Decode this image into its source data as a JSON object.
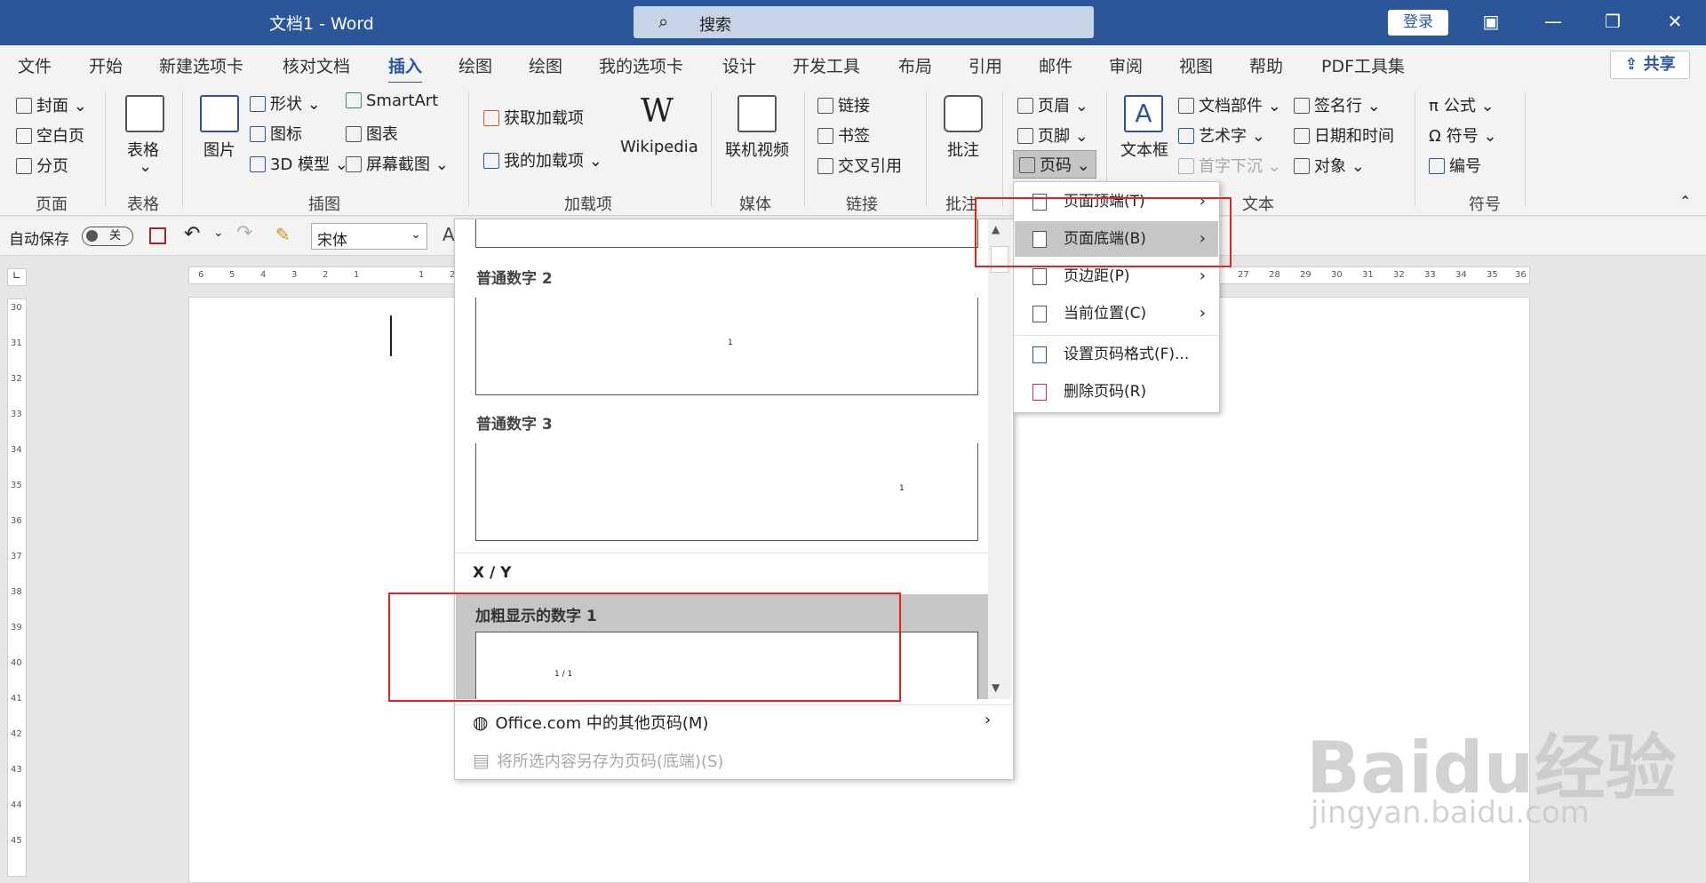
{
  "titlebar": {
    "title": "文档1  -  Word",
    "search_placeholder": "搜索",
    "login": "登录",
    "win_ribbon_opts": "▣",
    "win_minimize": "—",
    "win_restore": "❐",
    "win_close": "✕"
  },
  "tabs": [
    "文件",
    "开始",
    "新建选项卡",
    "核对文档",
    "插入",
    "绘图",
    "绘图",
    "我的选项卡",
    "设计",
    "开发工具",
    "布局",
    "引用",
    "邮件",
    "审阅",
    "视图",
    "帮助",
    "PDF工具集"
  ],
  "active_tab": "插入",
  "share": "共享",
  "ribbon": {
    "page_group": {
      "cover": "封面",
      "blank": "空白页",
      "break": "分页",
      "label": "页面"
    },
    "table_group": {
      "table": "表格",
      "label": "表格"
    },
    "illus_group": {
      "picture": "图片",
      "shapes": "形状",
      "icons": "图标",
      "model3d": "3D 模型",
      "smartart": "SmartArt",
      "chart": "图表",
      "screenshot": "屏幕截图",
      "label": "插图"
    },
    "addin_group": {
      "get": "获取加载项",
      "my": "我的加载项",
      "wiki": "Wikipedia",
      "label": "加载项"
    },
    "media_group": {
      "video": "联机视频",
      "label": "媒体"
    },
    "link_group": {
      "link": "链接",
      "bookmark": "书签",
      "cross": "交叉引用",
      "label": "链接"
    },
    "comment_group": {
      "comment": "批注",
      "label": "批注"
    },
    "hf_group": {
      "header": "页眉",
      "footer": "页脚",
      "pagenum": "页码"
    },
    "text_group": {
      "textbox": "文本框",
      "parts": "文档部件",
      "wordart": "艺术字",
      "dropcap": "首字下沉",
      "sigline": "签名行",
      "datetime": "日期和时间",
      "object": "对象",
      "label": "文本"
    },
    "symbol_group": {
      "equation": "公式",
      "symbol": "符号",
      "number": "编号",
      "label": "符号"
    }
  },
  "qat": {
    "autosave": "自动保存",
    "toggle": "关",
    "font": "宋体"
  },
  "gallery": {
    "sections": [
      "普通数字 2",
      "普通数字 3"
    ],
    "category": "X / Y",
    "selected": "加粗显示的数字 1",
    "preview_text": "1 / 1",
    "more": "Office.com 中的其他页码(M)",
    "save": "将所选内容另存为页码(底端)(S)"
  },
  "submenu": {
    "items": [
      "页面顶端(T)",
      "页面底端(B)",
      "页边距(P)",
      "当前位置(C)",
      "设置页码格式(F)...",
      "删除页码(R)"
    ]
  },
  "watermark": {
    "logo": "Baidu经验",
    "url": "jingyan.baidu.com"
  },
  "hruler_numbers": [
    "6",
    "5",
    "4",
    "3",
    "2",
    "1",
    "1",
    "2",
    "27",
    "28",
    "29",
    "30",
    "31",
    "32",
    "33",
    "34",
    "35",
    "36"
  ],
  "vruler_numbers": [
    "30",
    "31",
    "32",
    "33",
    "34",
    "35",
    "36",
    "37",
    "38",
    "39",
    "40",
    "41",
    "42",
    "43",
    "44",
    "45"
  ]
}
